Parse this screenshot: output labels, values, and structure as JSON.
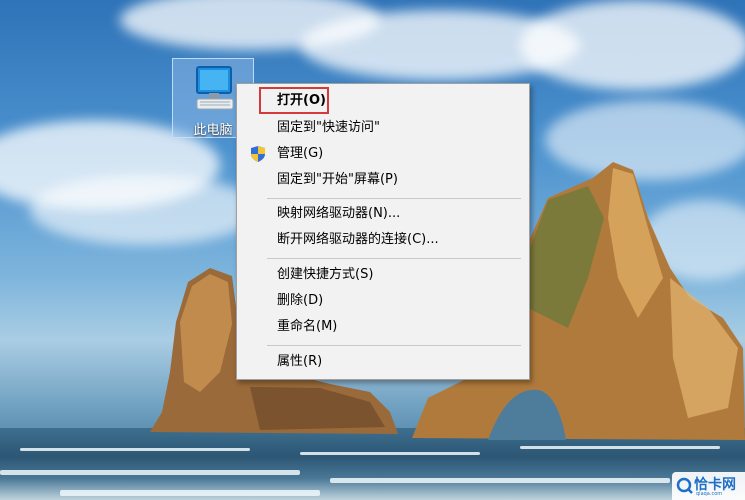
{
  "desktop_icon": {
    "label": "此电脑"
  },
  "context_menu": {
    "items": [
      {
        "label": "打开(O)",
        "bold": true
      },
      {
        "label": "固定到\"快速访问\""
      },
      {
        "label": "管理(G)"
      },
      {
        "label": "固定到\"开始\"屏幕(P)"
      },
      {
        "label": "映射网络驱动器(N)..."
      },
      {
        "label": "断开网络驱动器的连接(C)..."
      },
      {
        "label": "创建快捷方式(S)"
      },
      {
        "label": "删除(D)"
      },
      {
        "label": "重命名(M)"
      },
      {
        "label": "属性(R)"
      }
    ]
  },
  "watermark": {
    "text": "恰卡网",
    "sub": "qiaqa.com"
  },
  "colors": {
    "highlight_border": "#d43a3a",
    "menu_bg": "#f2f2f2",
    "watermark_blue": "#1f6fc7"
  }
}
